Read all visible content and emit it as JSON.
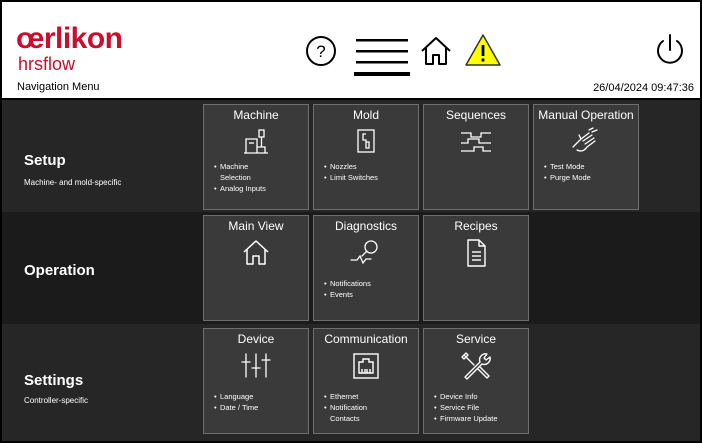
{
  "header": {
    "brand": "œrlikon",
    "brand_sub": "hrsflow",
    "nav_title": "Navigation Menu",
    "datetime": "26/04/2024 09:47:36",
    "icons": [
      "help-icon",
      "menu-icon",
      "home-icon",
      "warning-icon",
      "power-icon"
    ],
    "colors": {
      "brand": "#c8102e",
      "warning": "#ffff00"
    }
  },
  "sections": [
    {
      "title": "Setup",
      "subtitle": "Machine- and mold-specific",
      "tiles": [
        {
          "title": "Machine",
          "icon": "machine-icon",
          "items": [
            "Machine",
            "Selection",
            "Analog Inputs"
          ]
        },
        {
          "title": "Mold",
          "icon": "mold-icon",
          "items": [
            "Nozzles",
            "Limit Switches"
          ]
        },
        {
          "title": "Sequences",
          "icon": "sequences-icon",
          "items": []
        },
        {
          "title": "Manual Operation",
          "icon": "hand-icon",
          "items": [
            "Test Mode",
            "Purge Mode"
          ]
        }
      ]
    },
    {
      "title": "Operation",
      "subtitle": "",
      "tiles": [
        {
          "title": "Main View",
          "icon": "home-icon",
          "items": []
        },
        {
          "title": "Diagnostics",
          "icon": "diagnostics-icon",
          "items": [
            "Notifications",
            "Events"
          ]
        },
        {
          "title": "Recipes",
          "icon": "document-icon",
          "items": []
        }
      ]
    },
    {
      "title": "Settings",
      "subtitle": "Controller-specific",
      "tiles": [
        {
          "title": "Device",
          "icon": "sliders-icon",
          "items": [
            "Language",
            "Date / Time"
          ]
        },
        {
          "title": "Communication",
          "icon": "ethernet-icon",
          "items": [
            "Ethernet",
            "Notification",
            "Contacts"
          ]
        },
        {
          "title": "Service",
          "icon": "tools-icon",
          "items": [
            "Device Info",
            "Service File",
            "Firmware Update"
          ]
        }
      ]
    }
  ]
}
